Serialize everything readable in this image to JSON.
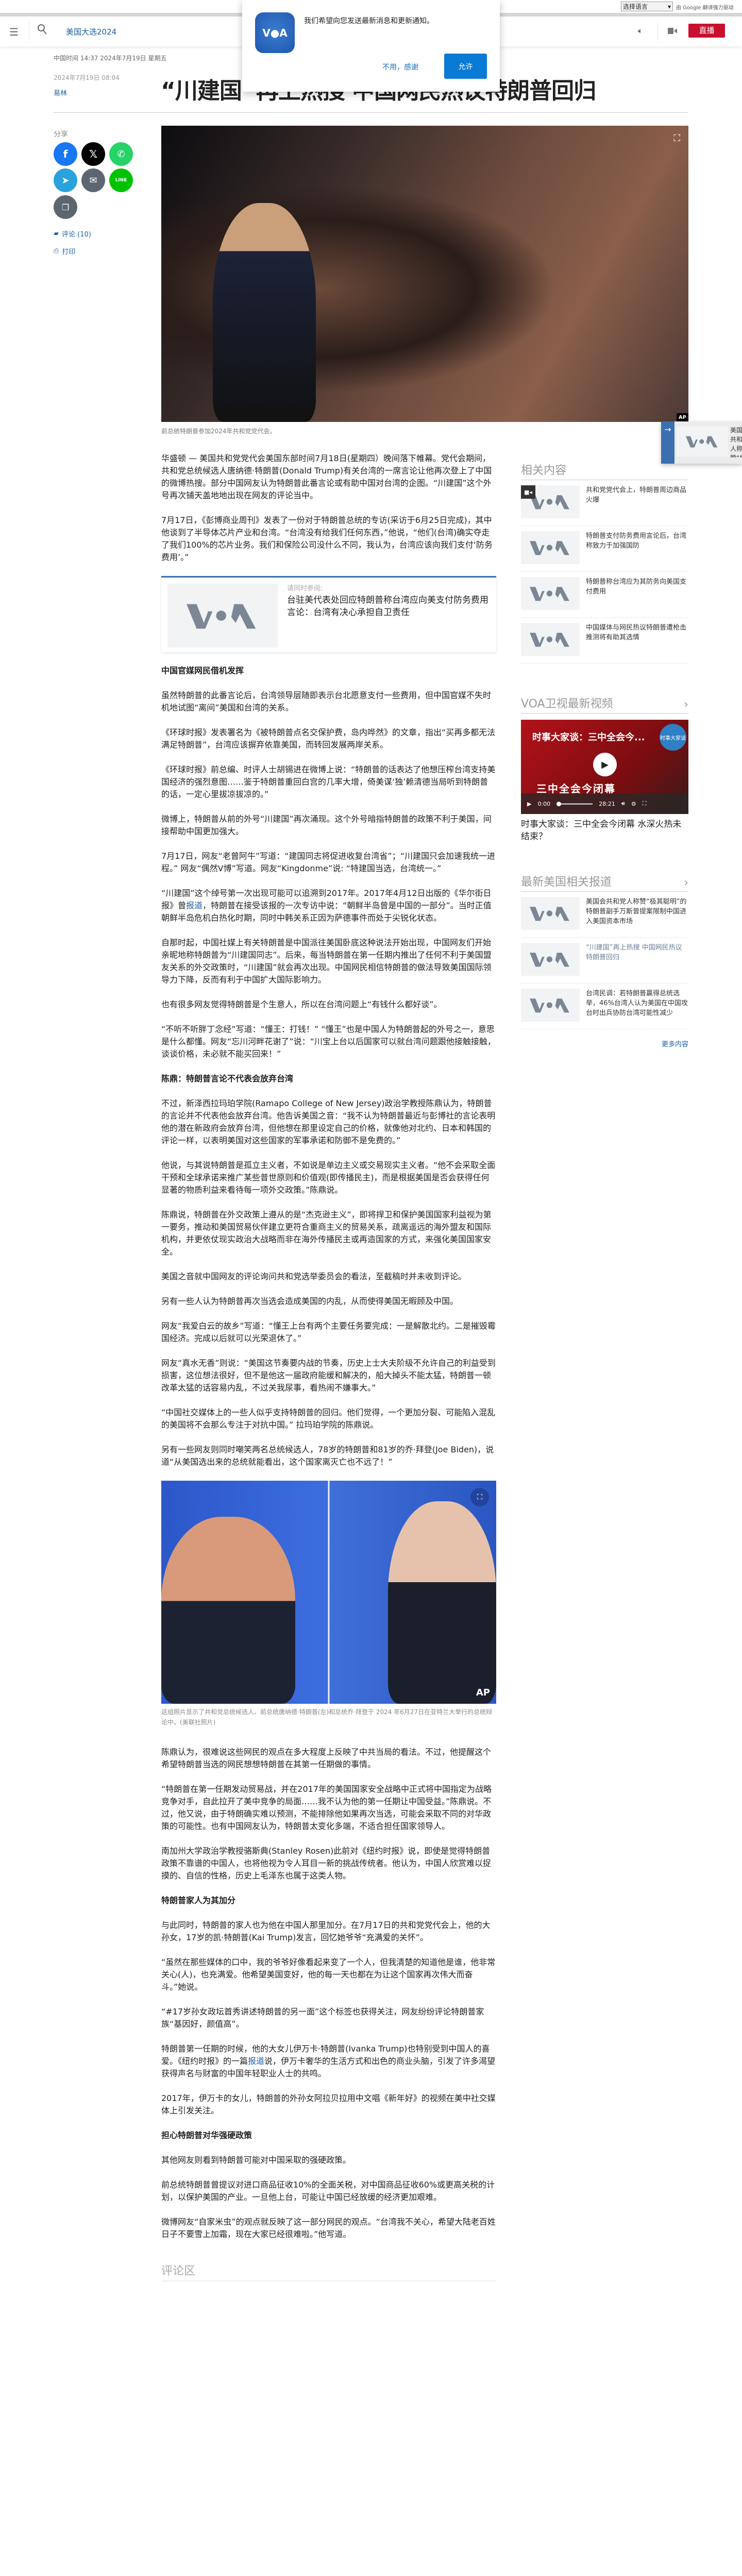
{
  "topbar": {
    "language_select": "选择语言",
    "powered_by": "由 Google 翻译强力驱动"
  },
  "header": {
    "nav_link": "美国大选2024",
    "live_label": "直播",
    "icons": [
      "menu-icon",
      "search-icon",
      "speaker-icon",
      "video-icon"
    ]
  },
  "notification": {
    "message": "我们希望向您发送最新消息和更新通知。",
    "decline": "不用，感谢",
    "allow": "允许",
    "allow_color": "#0a7bd4"
  },
  "article": {
    "local_time": "中国时间 14:37 2024年7月19日 星期五",
    "published": "2024年7月19日 08:04",
    "author": "易林",
    "title": "“川建国”再上热搜 中国网民热议特朗普回归",
    "hero_caption": "前总统特朗普参加2024年共和党党代会。",
    "hero_credit": "AP",
    "share_label": "分享",
    "share": [
      "facebook",
      "x",
      "whatsapp",
      "telegram",
      "email",
      "line",
      "copy-link"
    ],
    "comments_link": "评论 (10)",
    "print_link": "打印",
    "see_also": {
      "label": "请同时参阅:",
      "title": "台驻美代表处回应特朗普称台湾应向美支付防务费用言论：台湾有决心承担自卫责任"
    },
    "figure2": {
      "caption": "这组照片显示了共和党总统候选人、前总统唐纳德·特朗普(左)和总统乔·拜登于 2024 年6月27日在亚特兰大举行的总统辩论中。(美联社照片)",
      "credit": "AP"
    },
    "comments_heading": "评论区",
    "blocks": [
      {
        "type": "p",
        "text": "华盛顿 — 美国共和党党代会美国东部时间7月18日(星期四）晚间落下帷幕。党代会期间，共和党总统候选人唐纳德·特朗普(Donald Trump)有关台湾的一席言论让他再次登上了中国的微博热搜。部分中国网友认为特朗普此番言论或有助中国对台湾的企图。“川建国”这个外号再次铺天盖地地出现在网友的评论当中。"
      },
      {
        "type": "p",
        "text": "7月17日，《彭博商业周刊》发表了一份对于特朗普总统的专访(采访于6月25日完成)，其中他谈到了半导体芯片产业和台湾。“台湾没有给我们任何东西，”他说，“他们(台湾)确实夺走了我们100%的芯片业务。我们和保险公司没什么不同，我认为，台湾应该向我们支付‘防务费用’。”"
      },
      {
        "type": "seealso"
      },
      {
        "type": "h",
        "text": "中国官媒网民借机发挥"
      },
      {
        "type": "p",
        "text": "虽然特朗普的此番言论后，台湾领导层随即表示台北愿意支付一些费用，但中国官媒不失时机地试图“离间”美国和台湾的关系。"
      },
      {
        "type": "p",
        "text": "《环球时报》发表署名为《被特朗普点名交保护费，岛内哗然》的文章，指出“买再多都无法满足特朗普”，台湾应该摒弃依靠美国，而转回发展两岸关系。"
      },
      {
        "type": "p",
        "text": "《环球时报》前总编、时评人士胡锡进在微博上说：“特朗普的话表达了他想压榨台湾支持美国经济的强烈意图……鉴于特朗普重回白宫的几率大增，倚美谋‘独’赖清德当局听到特朗普的话，一定心里拔凉拔凉的。”"
      },
      {
        "type": "p",
        "text": "微博上，特朗普从前的外号“川建国”再次涌现。这个外号暗指特朗普的政策不利于美国，间接帮助中国更加强大。"
      },
      {
        "type": "p",
        "text": "7月17日，网友“老曾阿牛”写道：“建国同志将促进收复台湾省”；“川建国只会加速我统一进程。” 网友“偶然V博”写道。网友“Kingdonme”说: “特建国当选，台湾统一。”"
      },
      {
        "type": "plink",
        "before": "“川建国”这个绰号第一次出现可能可以追溯到2017年。2017年4月12日出版的《华尔街日报》曾",
        "link": "报道",
        "after": "，特朗普在接受该报的一次专访中说：“朝鲜半岛曾是中国的一部分”。当时正值朝鲜半岛危机白热化时期，同时中韩关系正因为萨德事件而处于尖锐化状态。"
      },
      {
        "type": "p",
        "text": "自那时起，中国社媒上有关特朗普是中国派往美国卧底这种说法开始出现，中国网友们开始亲昵地称特朗普为“川建国同志”。后来，每当特朗普在第一任期内推出了任何不利于美国盟友关系的外交政策时，“川建国”就会再次出现。中国网民相信特朗普的做法导致美国国际领导力下降，反而有利于中国扩大国际影响力。"
      },
      {
        "type": "p",
        "text": "也有很多网友觉得特朗普是个生意人，所以在台湾问题上“有钱什么都好谈”。"
      },
      {
        "type": "p",
        "text": "“不听不听胖丁念经”写道：“懂王：打钱！” “懂王”也是中国人为特朗普起的外号之一，意思是什么都懂。网友“忘川河畔花谢了”说：“川宝上台以后国家可以就台湾问题跟他接触接触，谈谈价格，未必就不能买回来！”"
      },
      {
        "type": "h",
        "text": "陈鼎：特朗普言论不代表会放弃台湾"
      },
      {
        "type": "p",
        "text": "不过，新泽西拉玛珀学院(Ramapo College of New Jersey)政治学教授陈鼎认为，特朗普的言论并不代表他会放弃台湾。他告诉美国之音：“我不认为特朗普最近与彭博社的言论表明他的潜在新政府会放弃台湾，但他想在那里设定自己的价格，就像他对北约、日本和韩国的评论一样，以表明美国对这些国家的军事承诺和防御不是免费的。”"
      },
      {
        "type": "p",
        "text": "他说，与其说特朗普是孤立主义者，不如说是单边主义或交易现实主义者。“他不会采取全面干预和全球承诺来推广某些普世原则和价值观(即传播民主)，而是根据美国是否会获得任何显著的物质利益来看待每一项外交政策。”陈鼎说。"
      },
      {
        "type": "p",
        "text": "陈鼎说，特朗普在外交政策上遵从的是“杰克逊主义”，即将捍卫和保护美国国家利益视为第一要务，推动和美国贸易伙伴建立更符合重商主义的贸易关系，疏离遥远的海外盟友和国际机构，并更依仗现实政治大战略而非在海外传播民主或再造国家的方式，来强化美国国家安全。"
      },
      {
        "type": "p",
        "text": "美国之音就中国网友的评论询问共和党选举委员会的看法，至截稿时并未收到评论。"
      },
      {
        "type": "p",
        "text": "另有一些人认为特朗普再次当选会造成美国的内乱，从而使得美国无暇顾及中国。"
      },
      {
        "type": "p",
        "text": "网友“我爱白云的故乡”写道：“懂王上台有两个主要任务要完成：一是解散北约。二是摧毁霉国经济。完成以后就可以光荣退休了。”"
      },
      {
        "type": "p",
        "text": "网友“真水无香”则说：“美国这节奏要内战的节奏，历史上士大夫阶级不允许自己的利益受到损害，这位想法很好，但不是他这一届政府能缓和解决的，船大掉头不能太猛，特朗普一顿改革太猛的话容易内乱，不过关我尿事，看热闹不嫌事大。”"
      },
      {
        "type": "p",
        "text": "“中国社交媒体上的一些人似乎支持特朗普的回归。他们觉得，一个更加分裂、可能陷入混乱的美国将不会那么专注于对抗中国。” 拉玛珀学院的陈鼎说。"
      },
      {
        "type": "p",
        "text": "另有一些网友则同时嘲笑两名总统候选人，78岁的特朗普和81岁的乔·拜登(Joe Biden)，说道“从美国选出来的总统就能看出，这个国家离灭亡也不远了！”"
      },
      {
        "type": "figure"
      },
      {
        "type": "p",
        "text": "陈鼎认为，很难说这些网民的观点在多大程度上反映了中共当局的看法。不过，他提醒这个希望特朗普当选的网民想想特朗普在其第一任期做的事情。"
      },
      {
        "type": "p",
        "text": "“特朗普在第一任期发动贸易战，并在2017年的美国国家安全战略中正式将中国指定为战略竞争对手，自此拉开了美中竞争的局面……我不认为他的第一任期让中国受益。”陈鼎说。不过，他又说，由于特朗确实难以预测，不能排除他如果再次当选，可能会采取不同的对华政策的可能性。也有中国网友认为，特朗普太变化多端，不适合担任国家领导人。"
      },
      {
        "type": "p",
        "text": "南加州大学政治学教授骆斯典(Stanley Rosen)此前对《纽约时报》说，即使是觉得特朗普政策不靠谱的中国人，也将他视为令人耳目一新的挑战传统者。他认为，中国人欣赏难以捉摸的、自信的性格，历史上毛泽东也属于这类人物。"
      },
      {
        "type": "h",
        "text": "特朗普家人为其加分"
      },
      {
        "type": "p",
        "text": "与此同时，特朗普的家人也为他在中国人那里加分。在7月17日的共和党党代会上，他的大孙女，17岁的凯·特朗普(Kai Trump)发言，回忆她爷爷“充满爱的关怀”。"
      },
      {
        "type": "p",
        "text": "“虽然在那些媒体的口中，我的爷爷好像看起来变了一个人，但我清楚的知道他是谁，他非常关心(人)，也充满爱。他希望美国变好，他的每一天也都在为让这个国家再次伟大而奋斗。”她说。"
      },
      {
        "type": "p",
        "text": "“#17岁孙女政坛首秀讲述特朗普的另一面”这个标签也获得关注，网友纷纷评论特朗普家族“基因好，颜值高”。"
      },
      {
        "type": "plink",
        "before": "特朗普第一任期的时候，他的大女儿伊万卡·特朗普(Ivanka Trump)也特别受到中国人的喜爱。《纽约时报》的一篇",
        "link": "报道",
        "after": "说，伊万卡奢华的生活方式和出色的商业头脑，引发了许多渴望获得声名与财富的中国年轻职业人士的共鸣。"
      },
      {
        "type": "p",
        "text": "2017年，伊万卡的女儿，特朗普的外孙女阿拉贝拉用中文唱《新年好》的视频在美中社交媒体上引发关注。"
      },
      {
        "type": "h",
        "text": "担心特朗普对华强硬政策"
      },
      {
        "type": "p",
        "text": "其他网友则看到特朗普可能对中国采取的强硬政策。"
      },
      {
        "type": "p",
        "text": "前总统特朗普曾提议对进口商品征收10%的全面关税，对中国商品征收60%或更高关税的计划，以保护美国的产业。一旦他上台，可能让中国已经放缓的经济更加艰难。"
      },
      {
        "type": "p",
        "text": "微博网友“自家米虫”的观点就反映了这一部分网民的观点。“台湾我不关心，希望大陆老百姓日子不要雪上加霜，现在大家已经很难啦。”他写道。"
      }
    ]
  },
  "sidebar": {
    "related_heading": "相关内容",
    "related": [
      {
        "title": "共和党党代会上，特朗普周边商品火爆",
        "video": true
      },
      {
        "title": "特朗普支付防务费用言论后，台湾称致力于加强国防"
      },
      {
        "title": "特朗普称台湾应为其防务向美国支付费用"
      },
      {
        "title": "中国媒体与网民热议特朗普遭枪击 推测将有助其选情"
      }
    ],
    "video_heading": "VOA卫视最新视频",
    "video": {
      "overlay_title": "时事大家谈：三中全会今...",
      "caption_banner": "三中全会今闭幕",
      "current_time": "0:00",
      "duration": "28:21",
      "title": "时事大家谈：三中全会今闭幕 水深火热未结束？",
      "badge": "时事大家谈"
    },
    "latest_heading": "最新美国相关报道",
    "latest": [
      {
        "title": "美国会共和党人称赞“极其聪明”的特朗普副手万斯曾提案限制中国进入美国资本市场"
      },
      {
        "title": "“川建国”再上热搜 中国网民热议特朗普回归",
        "current": true
      },
      {
        "title": "台湾民调：若特朗普赢得总统选举，46%台湾人认为美国在中国攻台时出兵协防台湾可能性减少"
      }
    ],
    "more_link": "更多内容"
  },
  "floating_next": {
    "title": "美国会共和党人称赞“极其聪明”的特朗普副手万斯曾提案限制中国进入美国资本市场"
  },
  "colors": {
    "brand_blue": "#1a5fa8",
    "live_red": "#c8102e",
    "seealso_border": "#3b6fb0"
  }
}
